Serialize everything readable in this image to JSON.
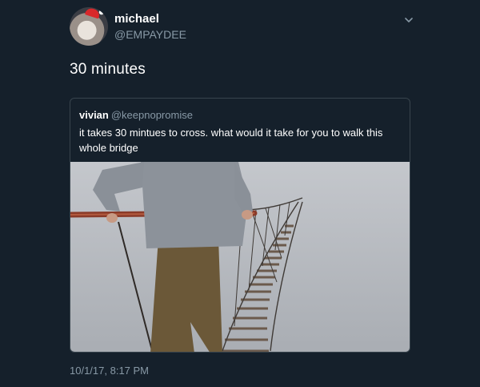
{
  "tweet": {
    "display_name": "michael",
    "handle": "@EMPAYDEE",
    "text": "30 minutes",
    "timestamp": "10/1/17, 8:17 PM",
    "menu_icon": "chevron-down-icon"
  },
  "quoted_tweet": {
    "display_name": "vivian",
    "handle": "@keepnopromise",
    "text": "it takes 30 mintues to cross. what would it take for you to walk this whole bridge"
  },
  "colors": {
    "background": "#15202b",
    "secondary_text": "#8899a6",
    "border": "#38444d"
  }
}
